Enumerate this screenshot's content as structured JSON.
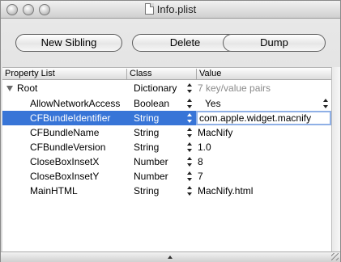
{
  "window": {
    "title": "Info.plist"
  },
  "toolbar": {
    "new_sibling": "New Sibling",
    "delete": "Delete",
    "dump": "Dump"
  },
  "columns": {
    "property_list": "Property List",
    "class": "Class",
    "value": "Value"
  },
  "root": {
    "key": "Root",
    "class": "Dictionary",
    "value": "7 key/value pairs"
  },
  "rows": [
    {
      "key": "AllowNetworkAccess",
      "class": "Boolean",
      "value": "Yes"
    },
    {
      "key": "CFBundleIdentifier",
      "class": "String",
      "value": "com.apple.widget.macnify"
    },
    {
      "key": "CFBundleName",
      "class": "String",
      "value": "MacNify"
    },
    {
      "key": "CFBundleVersion",
      "class": "String",
      "value": "1.0"
    },
    {
      "key": "CloseBoxInsetX",
      "class": "Number",
      "value": "8"
    },
    {
      "key": "CloseBoxInsetY",
      "class": "Number",
      "value": "7"
    },
    {
      "key": "MainHTML",
      "class": "String",
      "value": "MacNify.html"
    }
  ],
  "selected_row": "CFBundleIdentifier",
  "colors": {
    "selection": "#3875d7",
    "root_value": "#8a8a8a"
  },
  "icons": [
    "document-icon",
    "disclosure-triangle-icon",
    "stepper-icon",
    "scroll-up-icon",
    "resize-grip-icon"
  ]
}
